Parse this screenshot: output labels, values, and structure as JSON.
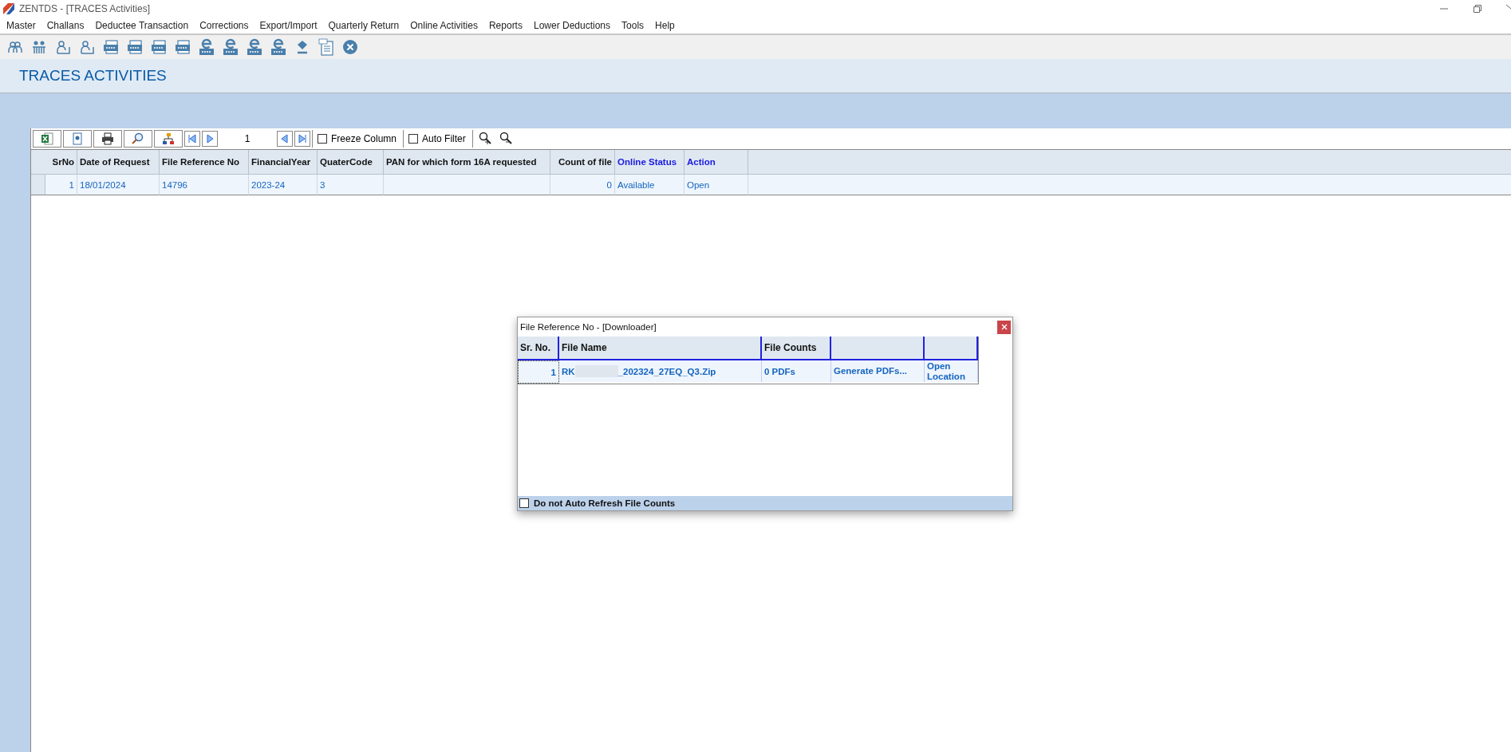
{
  "window": {
    "title": "ZENTDS - [TRACES Activities]"
  },
  "menu": [
    "Master",
    "Challans",
    "Deductee Transaction",
    "Corrections",
    "Export/Import",
    "Quarterly Return",
    "Online Activities",
    "Reports",
    "Lower Deductions",
    "Tools",
    "Help"
  ],
  "toolbar": [
    {
      "kind": "people"
    },
    {
      "kind": "group"
    },
    {
      "kind": "person"
    },
    {
      "kind": "person"
    },
    {
      "kind": "form"
    },
    {
      "kind": "form"
    },
    {
      "kind": "form"
    },
    {
      "kind": "form"
    },
    {
      "kind": "eform"
    },
    {
      "kind": "eform"
    },
    {
      "kind": "eform"
    },
    {
      "kind": "eform"
    },
    {
      "kind": "tds"
    },
    {
      "kind": "pdf"
    },
    {
      "kind": "close"
    }
  ],
  "page_title": "TRACES ACTIVITIES",
  "grid_toolbar": {
    "page": "1",
    "freeze_column": {
      "label": "Freeze Column",
      "checked": false
    },
    "auto_filter": {
      "label": "Auto Filter",
      "checked": false
    }
  },
  "table": {
    "columns": [
      {
        "label": "SrNo",
        "kind": "number"
      },
      {
        "label": "Date of Request",
        "kind": "text"
      },
      {
        "label": "File Reference No",
        "kind": "text"
      },
      {
        "label": "FinancialYear",
        "kind": "text"
      },
      {
        "label": "QuaterCode",
        "kind": "text"
      },
      {
        "label": "PAN for which form 16A requested",
        "kind": "text"
      },
      {
        "label": "Count of file",
        "kind": "number"
      },
      {
        "label": "Online Status",
        "kind": "link"
      },
      {
        "label": "Action",
        "kind": "link"
      }
    ],
    "rows": [
      [
        "1",
        "18/01/2024",
        "14796",
        "2023-24",
        "3",
        "",
        "0",
        "Available",
        "Open"
      ]
    ]
  },
  "dialog": {
    "title": "File Reference No -  [Downloader]",
    "columns": [
      "Sr. No.",
      "File Name",
      "File Counts",
      "",
      ""
    ],
    "rows": [
      {
        "sr": "1",
        "file_name_start": "RK",
        "file_name_end": "_202324_27EQ_Q3.Zip",
        "file_counts": "0 PDFs",
        "generate": "Generate PDFs...",
        "open": "Open Location"
      }
    ],
    "footer": {
      "label": "Do not Auto Refresh File Counts",
      "checked": false
    }
  }
}
